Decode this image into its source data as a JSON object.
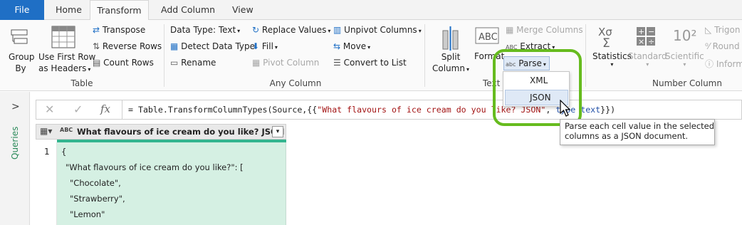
{
  "menu": {
    "tabs": [
      "File",
      "Home",
      "Transform",
      "Add Column",
      "View"
    ],
    "active": "Transform"
  },
  "ribbon": {
    "table": {
      "label": "Table",
      "group_by": [
        "Group",
        "By"
      ],
      "use_first_row": [
        "Use First Row",
        "as Headers"
      ],
      "transpose": "Transpose",
      "reverse_rows": "Reverse Rows",
      "count_rows": "Count Rows"
    },
    "any_column": {
      "label": "Any Column",
      "data_type": "Data Type: Text",
      "detect_data_type": "Detect Data Type",
      "rename": "Rename",
      "replace_values": "Replace Values",
      "fill": "Fill",
      "pivot_column": "Pivot Column",
      "unpivot_columns": "Unpivot Columns",
      "move": "Move",
      "convert_to_list": "Convert to List"
    },
    "text_column": {
      "label": "Text C",
      "split_column": [
        "Split",
        "Column"
      ],
      "format": "Format",
      "merge_columns": "Merge Columns",
      "extract": "Extract",
      "parse": "Parse"
    },
    "number_column": {
      "label": "Number Column",
      "statistics": "Statistics",
      "standard": "Standard",
      "scientific": "Scientific",
      "trig": "Trigon",
      "round": "Round",
      "info": "Inform"
    }
  },
  "parse_menu": {
    "items": [
      "XML",
      "JSON"
    ],
    "selected": "JSON"
  },
  "tooltip": {
    "line1": "Parse each cell value in the selected",
    "line2": "columns as a JSON document."
  },
  "left_pane": {
    "label": "Queries",
    "expand_glyph": ">"
  },
  "formula_bar": {
    "fx": "fx",
    "prefix": "= Table.TransformColumnTypes(Source,{{",
    "string": "\"What flavours of ice cream do you like? JSON\"",
    "sep": ", ",
    "kw1": "type",
    "kw2": "text",
    "suffix": "}})"
  },
  "grid": {
    "column_header": "What flavours of ice cream do you like? JSON",
    "type_icon": "ABC",
    "row_number": "1",
    "cell_lines": [
      "{",
      "\"What flavours of ice cream do you like?\": [",
      "\"Chocolate\",",
      "\"Strawberry\",",
      "\"Lemon\""
    ]
  },
  "colors": {
    "accent_blue": "#1f6fc5",
    "highlight_green": "#66bb1e",
    "cell_green": "#d5f0e3"
  }
}
